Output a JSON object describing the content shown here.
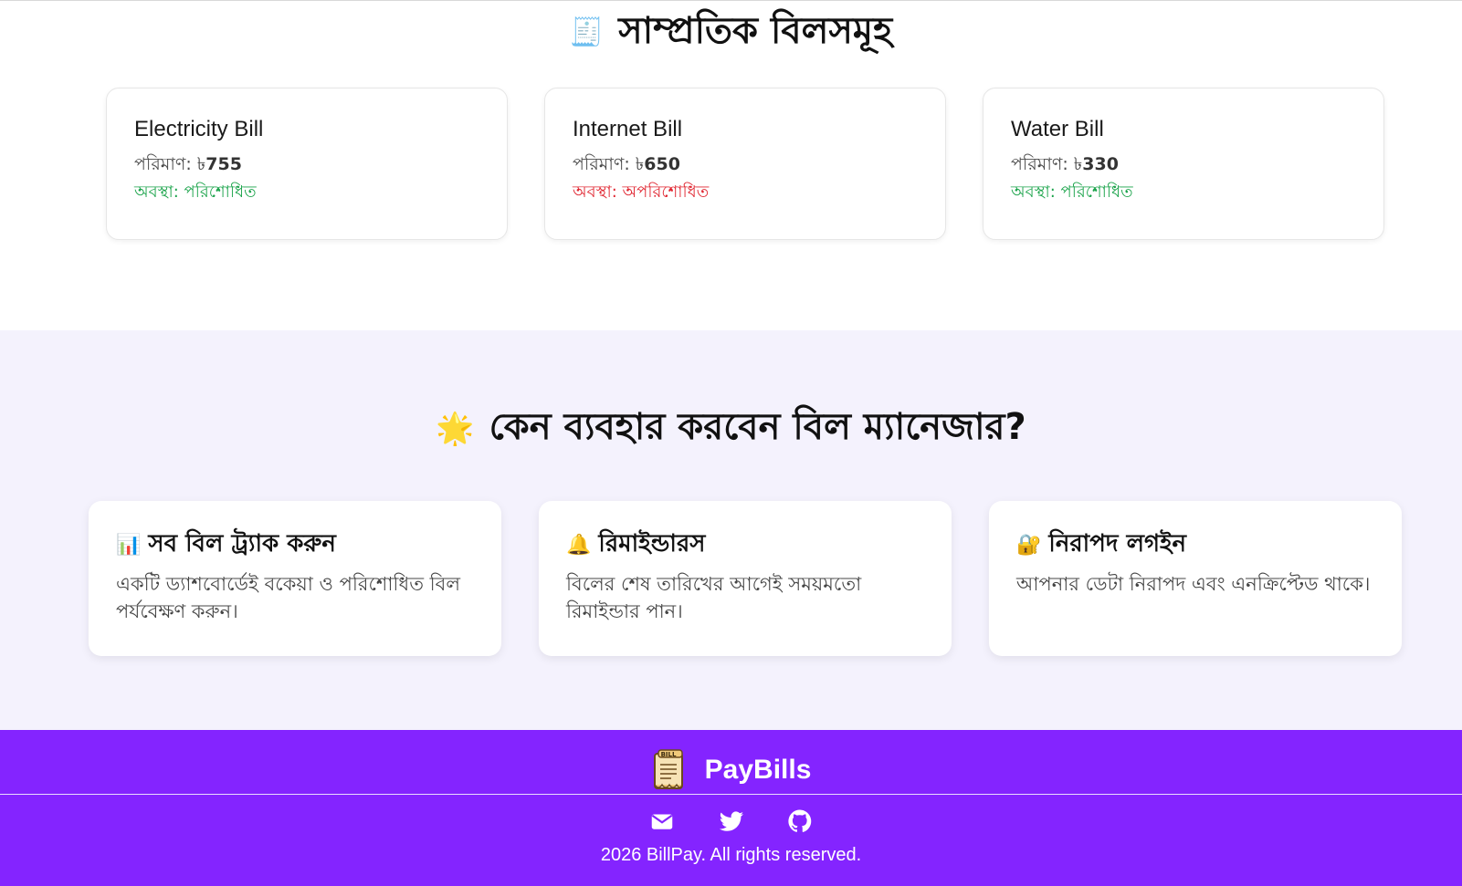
{
  "recent": {
    "icon": "receipt-icon",
    "title_emoji": "🧾",
    "title": "সাম্প্রতিক বিলসমূহ",
    "bills": [
      {
        "name": "Electricity Bill",
        "amount_label": "পরিমাণ: ৳",
        "amount": "755",
        "status": "অবস্থা: পরিশোধিত",
        "status_color": "#1aa34a"
      },
      {
        "name": "Internet Bill",
        "amount_label": "পরিমাণ: ৳",
        "amount": "650",
        "status": "অবস্থা: অপরিশোধিত",
        "status_color": "#e0242f"
      },
      {
        "name": "Water Bill",
        "amount_label": "পরিমাণ: ৳",
        "amount": "330",
        "status": "অবস্থা: পরিশোধিত",
        "status_color": "#1aa34a"
      }
    ]
  },
  "why": {
    "title_emoji": "🌟",
    "title": "কেন ব্যবহার করবেন বিল ম্যানেজার?",
    "features": [
      {
        "icon": "bar-chart-icon",
        "emoji": "📊",
        "title": "সব বিল ট্র্যাক করুন",
        "desc": "একটি ড্যাশবোর্ডেই বকেয়া ও পরিশোধিত বিল পর্যবেক্ষণ করুন।"
      },
      {
        "icon": "bell-icon",
        "emoji": "🔔",
        "title": "রিমাইন্ডারস",
        "desc": "বিলের শেষ তারিখের আগেই সময়মতো রিমাইন্ডার পান।"
      },
      {
        "icon": "lock-icon",
        "emoji": "🔐",
        "title": "নিরাপদ লগইন",
        "desc": "আপনার ডেটা নিরাপদ এবং এনক্রিপ্টেড থাকে।"
      }
    ]
  },
  "footer": {
    "brand": "PayBills",
    "logo_text": "BILL",
    "socials": [
      "mail-icon",
      "twitter-icon",
      "github-icon"
    ],
    "copyright": "2026 BillPay. All rights reserved.",
    "bg_color": "#8424ff"
  }
}
